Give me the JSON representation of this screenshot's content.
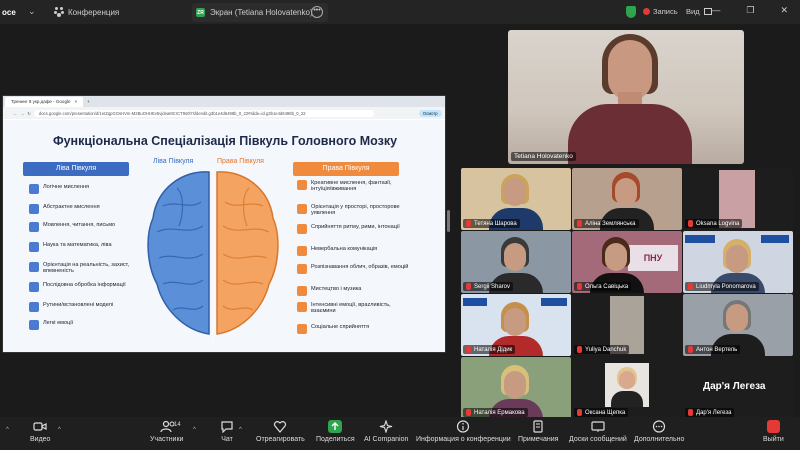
{
  "topbar": {
    "brand": "oce",
    "conference": "Конференция",
    "share_tab": "Экран (Tetiana Holovatenko)",
    "share_badge": "ZR",
    "record": "Запись",
    "view": "Вид"
  },
  "browser": {
    "tab_title": "Тренинг 8 укр.дафе - Google",
    "url": "docs.google.com/presentation/d/1eIZqpGGsHVm-M2BuOHHEv5vjdeaMCrCT9s0l7sfdendit.g3b1e4d6498b_0_22#slide=id.g3b1e4d6498b_0_22",
    "share_btn": "Осмотр"
  },
  "slide": {
    "title": "Функціональна Спеціалізація Півкуль Головного Мозку",
    "left_header": "Ліва Півкуля",
    "right_header": "Права Півкуля",
    "left_label": "Ліва Півкуля",
    "right_label": "Права Півкуля",
    "left_items": [
      "Логічне мислення",
      "Абстрактне мислення",
      "Мовлення, читання, письмо",
      "Наука та математика, ліва",
      "Орієнтація на реальність, захист, впевненість",
      "Послідовна обробка інформації",
      "Рутини/встановлені моделі",
      "Легкі емоції"
    ],
    "right_items": [
      "Креативне мислення, фантазії, інтуїція/вживання",
      "Орієнтація у просторі, просторове уявлення",
      "Сприйняття ритму, рими, інтонації",
      "Невербальна комунікація",
      "Розпізнавання облич, образів, емоцій",
      "Мистецтво і музика",
      "Інтенсивні емоції, врazливість, взаємини",
      "Соціальне сприйняття"
    ]
  },
  "speaker": {
    "name": "Tetiana Holovatenko"
  },
  "participants": [
    {
      "name": "Тетяна Шарова"
    },
    {
      "name": "Аліна Землянська"
    },
    {
      "name": "Oksana Logvina"
    },
    {
      "name": "Sergii Sharov"
    },
    {
      "name": "Ольга Савіцька"
    },
    {
      "name": "Liudmyla Ponomarova"
    },
    {
      "name": "Наталія Дідик"
    },
    {
      "name": "Yuliya Danchuk"
    },
    {
      "name": "Антон Вертель"
    },
    {
      "name": "Наталія Ермакова"
    },
    {
      "name": "Оксана Щепка"
    },
    {
      "name": "Дар'я Легеза"
    }
  ],
  "big_name": "Дар'я Легеза",
  "toolbar": {
    "video": "Видео",
    "participants": "Участники",
    "participants_count": "14",
    "chat": "Чат",
    "react": "Отреагировать",
    "share": "Поделиться",
    "ai": "AI Companion",
    "info": "Информация о конференции",
    "notes": "Примечания",
    "whiteboard": "Доски сообщений",
    "more": "Дополнительно",
    "exit": "Выйти"
  },
  "colors": {
    "accent_green": "#2ea44f",
    "record_red": "#e53935",
    "left_blue": "#3b6cc1",
    "right_orange": "#f08a3c"
  }
}
